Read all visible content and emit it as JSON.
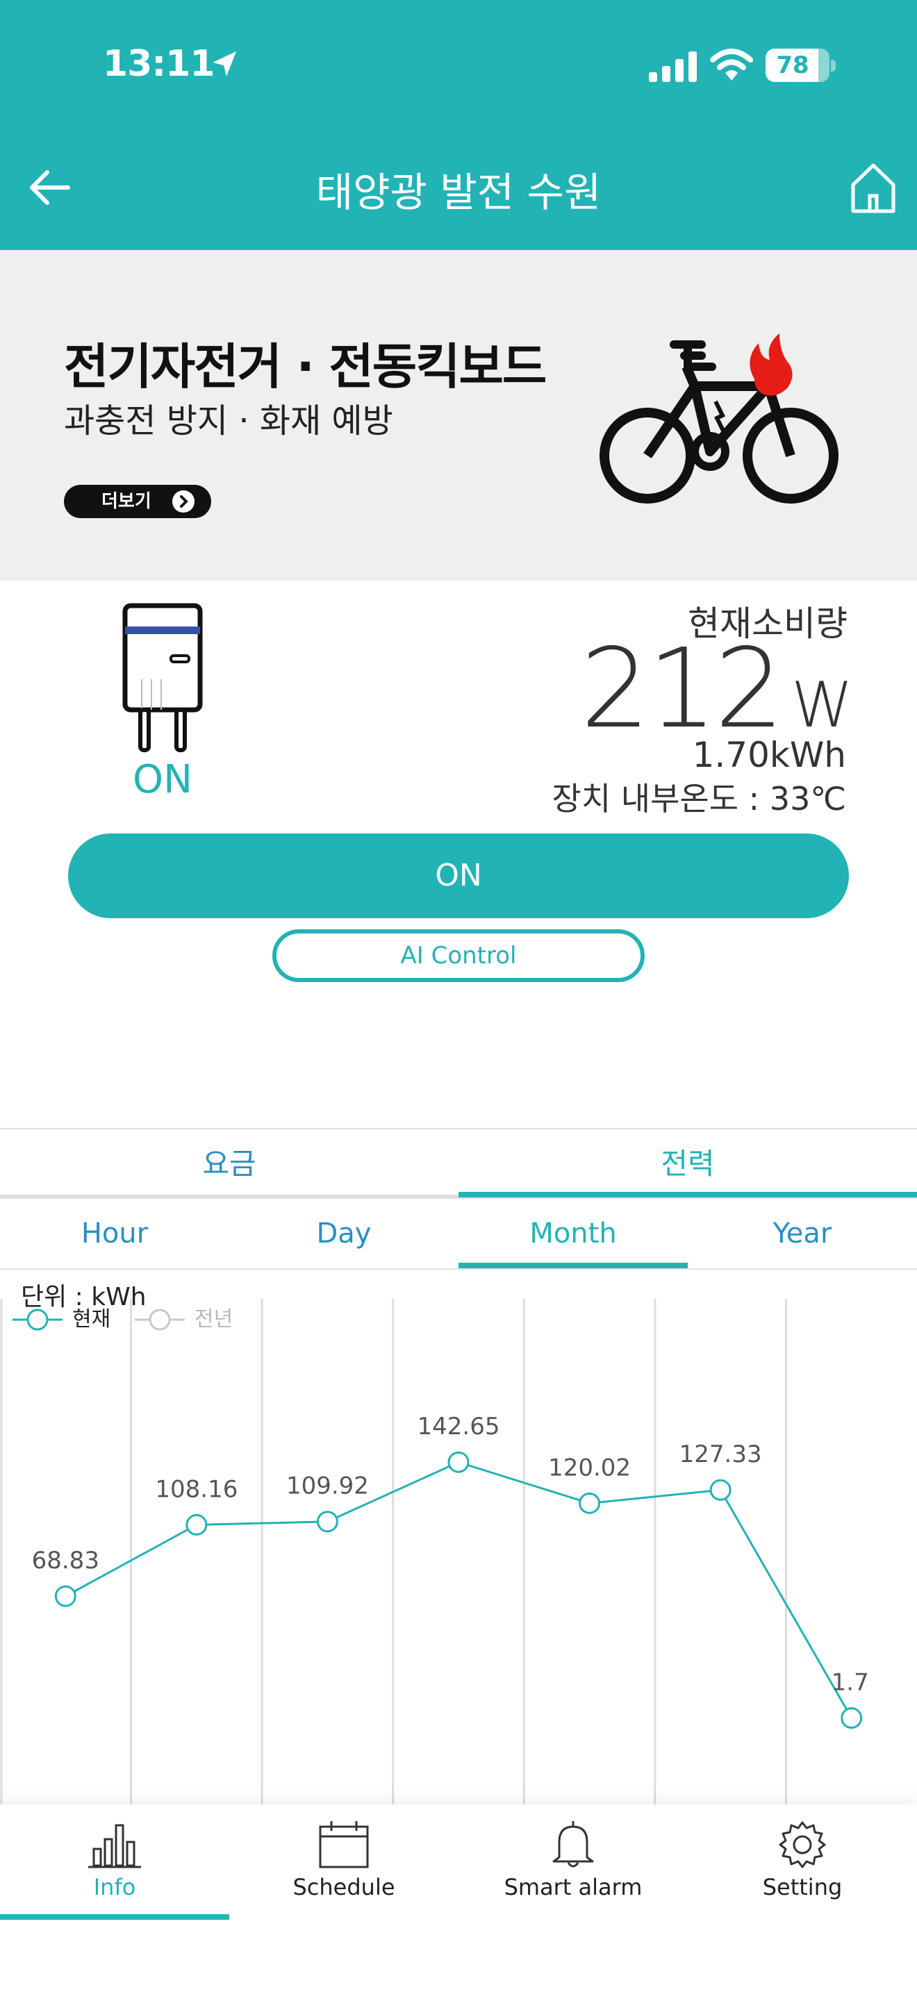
{
  "status_bar": {
    "time": "13:11",
    "battery": "78"
  },
  "header": {
    "title": "태양광 발전 수원"
  },
  "banner": {
    "title": "전기자전거 · 전동킥보드",
    "subtitle": "과충전 방지 · 화재 예방",
    "more_label": "더보기"
  },
  "device": {
    "state": "ON",
    "consumption_label": "현재소비량",
    "power_value": "212",
    "power_unit": "W",
    "energy": "1.70kWh",
    "temperature": "장치 내부온도 : 33℃",
    "on_button": "ON",
    "ai_button": "AI Control"
  },
  "tabs": {
    "main": [
      "요금",
      "전력"
    ],
    "main_active": 1,
    "period": [
      "Hour",
      "Day",
      "Month",
      "Year"
    ],
    "period_active": 2
  },
  "chart_data": {
    "type": "line",
    "unit_label": "단위 : kWh",
    "series": [
      {
        "name": "현재",
        "color": "#22b3b5",
        "values": [
          68.83,
          108.16,
          109.92,
          142.65,
          120.02,
          127.33,
          1.7
        ]
      },
      {
        "name": "전년",
        "color": "#c8c8c8",
        "values": []
      }
    ],
    "data_labels": [
      "68.83",
      "108.16",
      "109.92",
      "142.65",
      "120.02",
      "127.33",
      "1.7"
    ],
    "grid": "vertical"
  },
  "bottom_nav": {
    "items": [
      "Info",
      "Schedule",
      "Smart alarm",
      "Setting"
    ],
    "active": 0
  }
}
